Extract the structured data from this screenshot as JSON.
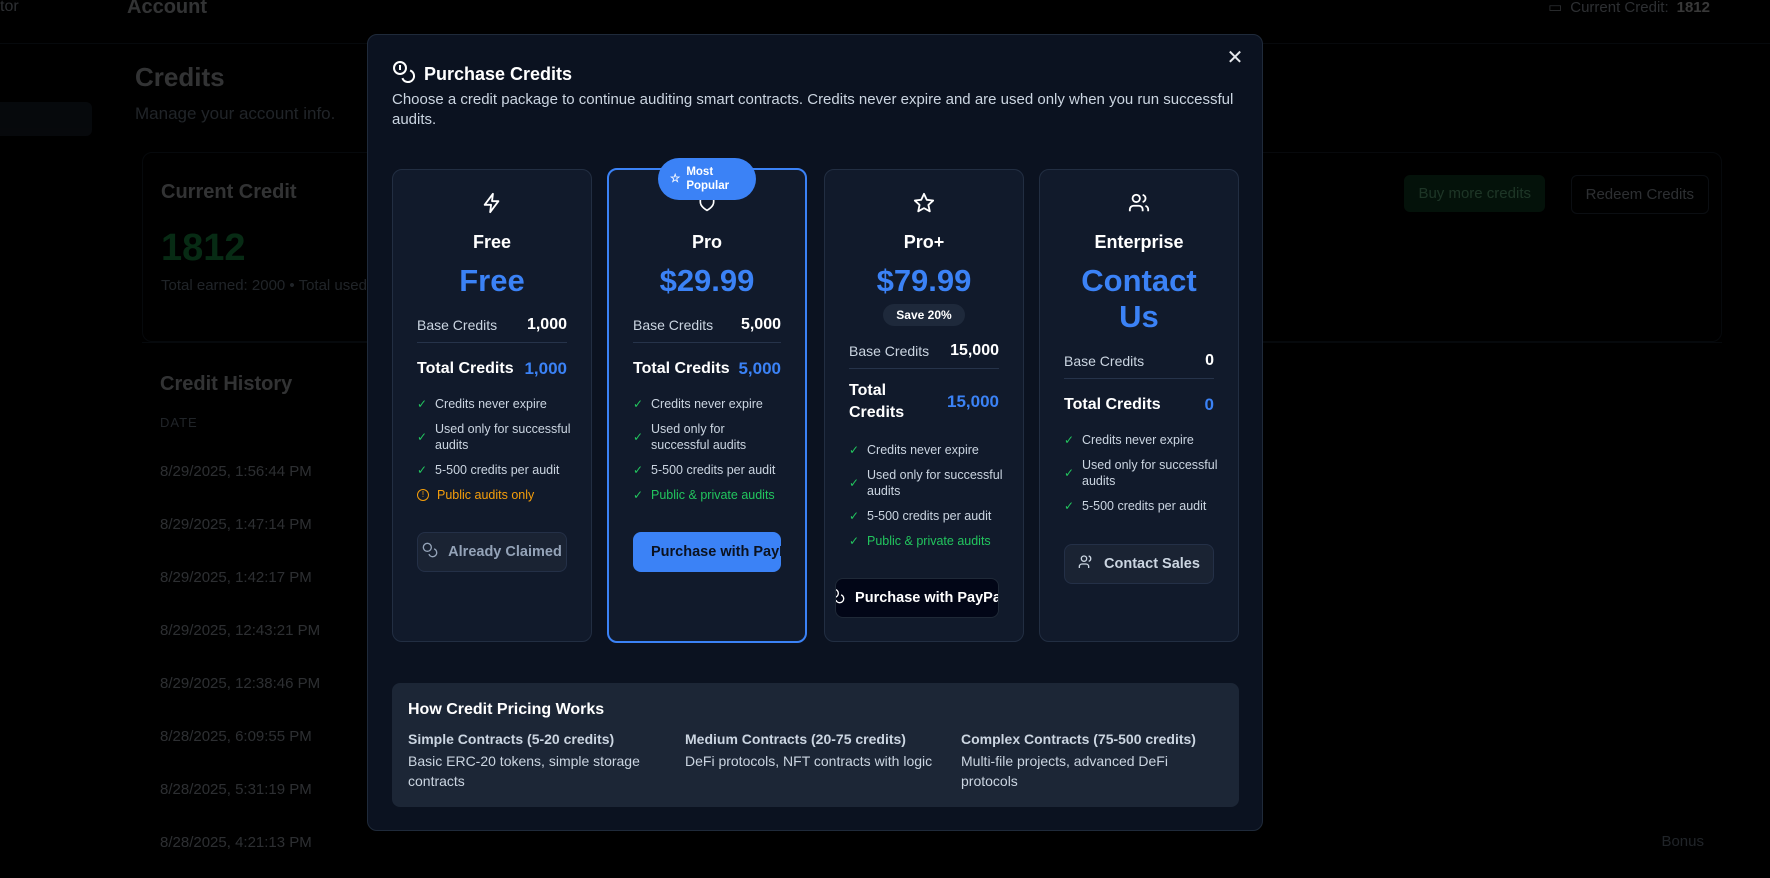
{
  "background": {
    "brand": "tor",
    "topbar_title": "Account",
    "current_credit_label": "Current Credit:",
    "current_credit_value": "1812",
    "page_title": "Credits",
    "page_subtitle": "Manage your account info.",
    "current_credit_card": {
      "title": "Current Credit",
      "value": "1812",
      "summary": "Total earned: 2000 • Total used",
      "buy_label": "Buy more credits",
      "redeem_label": "Redeem Credits"
    },
    "history": {
      "title": "Credit History",
      "date_header": "DATE",
      "rows": [
        "8/29/2025, 1:56:44 PM",
        "8/29/2025, 1:47:14 PM",
        "8/29/2025, 1:42:17 PM",
        "8/29/2025, 12:43:21 PM",
        "8/29/2025, 12:38:46 PM",
        "8/28/2025, 6:09:55 PM",
        "8/28/2025, 5:31:19 PM",
        "8/28/2025, 4:21:13 PM"
      ],
      "last_type": "Bonus"
    }
  },
  "modal": {
    "title": "Purchase Credits",
    "description": "Choose a credit package to continue auditing smart contracts. Credits never expire and are used only when you run successful audits.",
    "close_icon": "close-icon",
    "popular_badge": "Most Popular",
    "plans": [
      {
        "name": "Free",
        "price": "Free",
        "icon": "lightning-icon",
        "base_label": "Base Credits",
        "base_value": "1,000",
        "total_label": "Total Credits",
        "total_value": "1,000",
        "features": [
          "Credits never expire",
          "Used only for successful audits",
          "5-500 credits per audit"
        ],
        "access": "Public audits only",
        "button": "Already Claimed"
      },
      {
        "name": "Pro",
        "price": "$29.99",
        "icon": "shield-icon",
        "base_label": "Base Credits",
        "base_value": "5,000",
        "total_label": "Total Credits",
        "total_value": "5,000",
        "features": [
          "Credits never expire",
          "Used only for successful audits",
          "5-500 credits per audit"
        ],
        "access": "Public & private audits",
        "button": "Purchase with PayPal"
      },
      {
        "name": "Pro+",
        "price": "$79.99",
        "icon": "star-icon",
        "save": "Save 20%",
        "base_label": "Base Credits",
        "base_value": "15,000",
        "total_label": "Total Credits",
        "total_value": "15,000",
        "features": [
          "Credits never expire",
          "Used only for successful audits",
          "5-500 credits per audit"
        ],
        "access": "Public & private audits",
        "button": "Purchase with PayPal"
      },
      {
        "name": "Enterprise",
        "price": "Contact Us",
        "icon": "users-icon",
        "base_label": "Base Credits",
        "base_value": "0",
        "total_label": "Total Credits",
        "total_value": "0",
        "features": [
          "Credits never expire",
          "Used only for successful audits",
          "5-500 credits per audit"
        ],
        "button": "Contact Sales"
      }
    ],
    "how": {
      "title": "How Credit Pricing Works",
      "columns": [
        {
          "heading": "Simple Contracts (5-20 credits)",
          "body": "Basic ERC-20 tokens, simple storage contracts"
        },
        {
          "heading": "Medium Contracts (20-75 credits)",
          "body": "DeFi protocols, NFT contracts with logic"
        },
        {
          "heading": "Complex Contracts (75-500 credits)",
          "body": "Multi-file projects, advanced DeFi protocols"
        }
      ]
    }
  },
  "colors": {
    "accent": "#3b82f6",
    "success": "#22c55e",
    "warning": "#f59e0b",
    "modal_bg": "#0b1220",
    "card_bg": "#111a2b"
  }
}
